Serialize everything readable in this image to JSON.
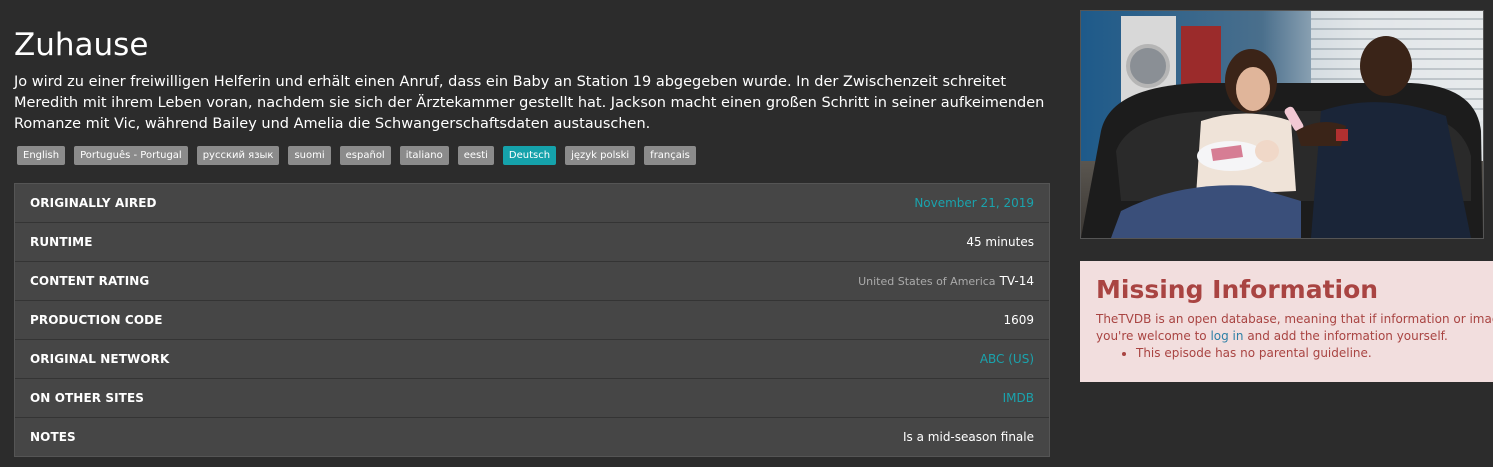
{
  "episode": {
    "title": "Zuhause",
    "overview": "Jo wird zu einer freiwilligen Helferin und erhält einen Anruf, dass ein Baby an Station 19 abgegeben wurde. In der Zwischenzeit schreitet Meredith mit ihrem Leben voran, nachdem sie sich der Ärztekammer gestellt hat. Jackson macht einen großen Schritt in seiner aufkeimenden Romanze mit Vic, während Bailey und Amelia die Schwangerschaftsdaten austauschen."
  },
  "languages": [
    {
      "label": "English",
      "active": false
    },
    {
      "label": "Português - Portugal",
      "active": false
    },
    {
      "label": "русский язык",
      "active": false
    },
    {
      "label": "suomi",
      "active": false
    },
    {
      "label": "español",
      "active": false
    },
    {
      "label": "italiano",
      "active": false
    },
    {
      "label": "eesti",
      "active": false
    },
    {
      "label": "Deutsch",
      "active": true
    },
    {
      "label": "język polski",
      "active": false
    },
    {
      "label": "français",
      "active": false
    }
  ],
  "details": {
    "originally_aired": {
      "label": "ORIGINALLY AIRED",
      "value": "November 21, 2019"
    },
    "runtime": {
      "label": "RUNTIME",
      "value": "45 minutes"
    },
    "content_rating": {
      "label": "CONTENT RATING",
      "country": "United States of America",
      "value": "TV-14"
    },
    "production_code": {
      "label": "PRODUCTION CODE",
      "value": "1609"
    },
    "original_network": {
      "label": "ORIGINAL NETWORK",
      "value": "ABC (US)"
    },
    "other_sites": {
      "label": "ON OTHER SITES",
      "value": "IMDB"
    },
    "notes": {
      "label": "NOTES",
      "value": "Is a mid-season finale"
    }
  },
  "missing": {
    "title": "Missing Information",
    "text_before_link": "TheTVDB is an open database, meaning that if information or images are missing,",
    "text_line2_start": "you're welcome to",
    "link_label": "log in",
    "text_after_link": "and add the information yourself.",
    "items": [
      "This episode has no parental guideline."
    ]
  },
  "colors": {
    "background": "#2c2c2c",
    "panel": "#464646",
    "accent": "#15a2ab",
    "link": "#1aa3ad",
    "alert_bg": "#f2dede",
    "alert_text": "#a94442"
  }
}
